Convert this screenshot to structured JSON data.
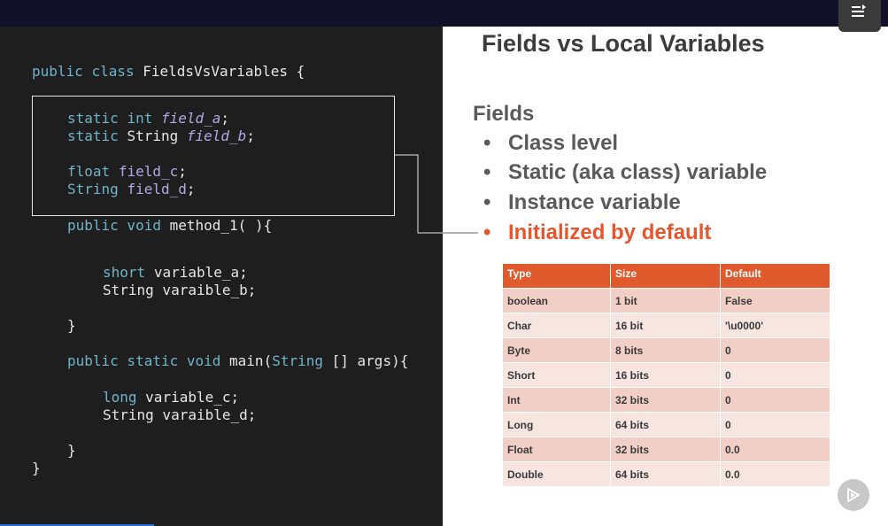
{
  "code": {
    "class_kw1": "public",
    "class_kw2": "class",
    "class_name": "FieldsVsVariables {",
    "field_a_static": "static",
    "field_a_type": "int",
    "field_a_name": "field_a",
    "field_a_end": ";",
    "field_b_static": "static",
    "field_b_type": "String",
    "field_b_name": "field_b",
    "field_b_end": ";",
    "field_c_type": "float",
    "field_c_name": "field_c",
    "field_c_end": ";",
    "field_d_type": "String",
    "field_d_name": "field_d",
    "field_d_end": ";",
    "method1_kw": "public void",
    "method1_sig": "method_1( ){",
    "var_a_type": "short",
    "var_a_rest": "variable_a;",
    "var_b_line": "String varaible_b;",
    "close1": "}",
    "main_kw": "public static void",
    "main_name": "main(",
    "main_type": "String",
    "main_rest": "[] args){",
    "var_c_type": "long",
    "var_c_rest": "variable_c;",
    "var_d_line": "String varaible_d;",
    "close2": "}",
    "close3": "}"
  },
  "slide": {
    "title": "Fields vs Local Variables",
    "section": "Fields",
    "bullet_symbol": "•",
    "bullets": [
      "Class level",
      "Static (aka class) variable",
      "Instance variable",
      "Initialized by default"
    ],
    "accent_color": "#e4572e"
  },
  "table": {
    "headers": [
      "Type",
      "Size",
      "Default"
    ],
    "rows": [
      [
        "boolean",
        "1 bit",
        "False"
      ],
      [
        "Char",
        "16 bit",
        "'\\u0000'"
      ],
      [
        "Byte",
        "8 bits",
        "0"
      ],
      [
        "Short",
        "16 bits",
        "0"
      ],
      [
        "Int",
        "32 bits",
        "0"
      ],
      [
        "Long",
        "64 bits",
        "0"
      ],
      [
        "Float",
        "32 bits",
        "0.0"
      ],
      [
        "Double",
        "64 bits",
        "0.0"
      ]
    ]
  },
  "controls": {
    "menu_icon": "menu-list-icon",
    "play_icon": "play-icon"
  }
}
